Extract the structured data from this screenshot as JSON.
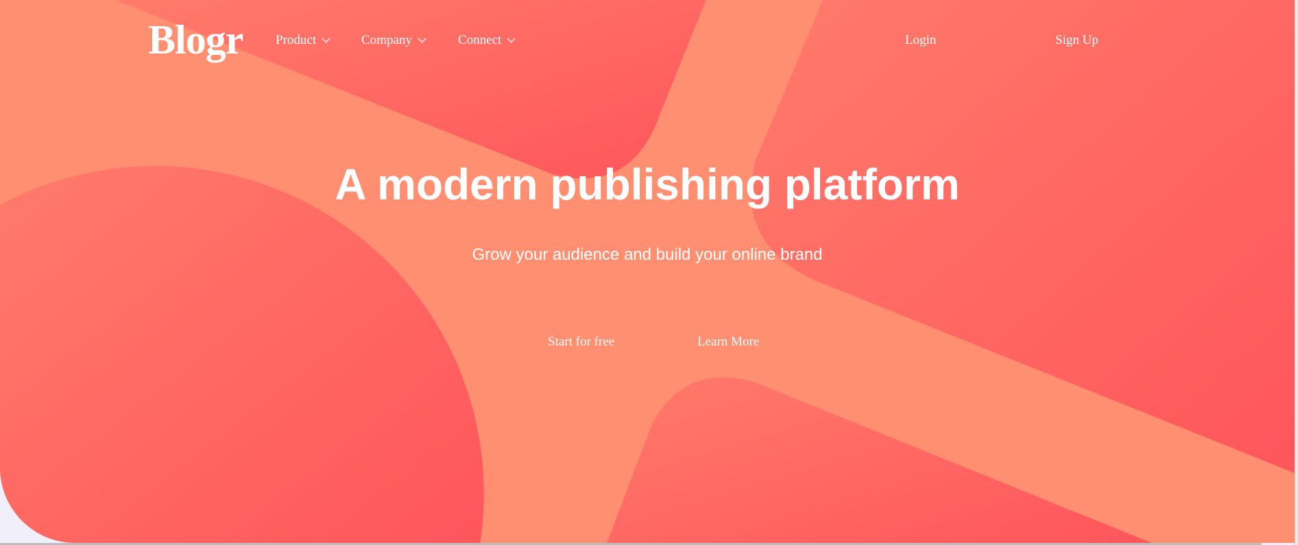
{
  "brand": {
    "logo": "Blogr"
  },
  "nav": {
    "items": [
      {
        "label": "Product",
        "icon": "chevron-down-icon"
      },
      {
        "label": "Company",
        "icon": "chevron-down-icon"
      },
      {
        "label": "Connect",
        "icon": "chevron-down-icon"
      }
    ],
    "login": "Login",
    "signup": "Sign Up"
  },
  "hero": {
    "title": "A modern publishing platform",
    "subtitle": "Grow your audience and build your online brand",
    "primary_cta": "Start for free",
    "secondary_cta": "Learn More"
  },
  "colors": {
    "salmon": "#ff8f70",
    "red_light": "#ff7a68",
    "red_dark": "#ff5a5f",
    "page_bg": "#f1effa"
  }
}
